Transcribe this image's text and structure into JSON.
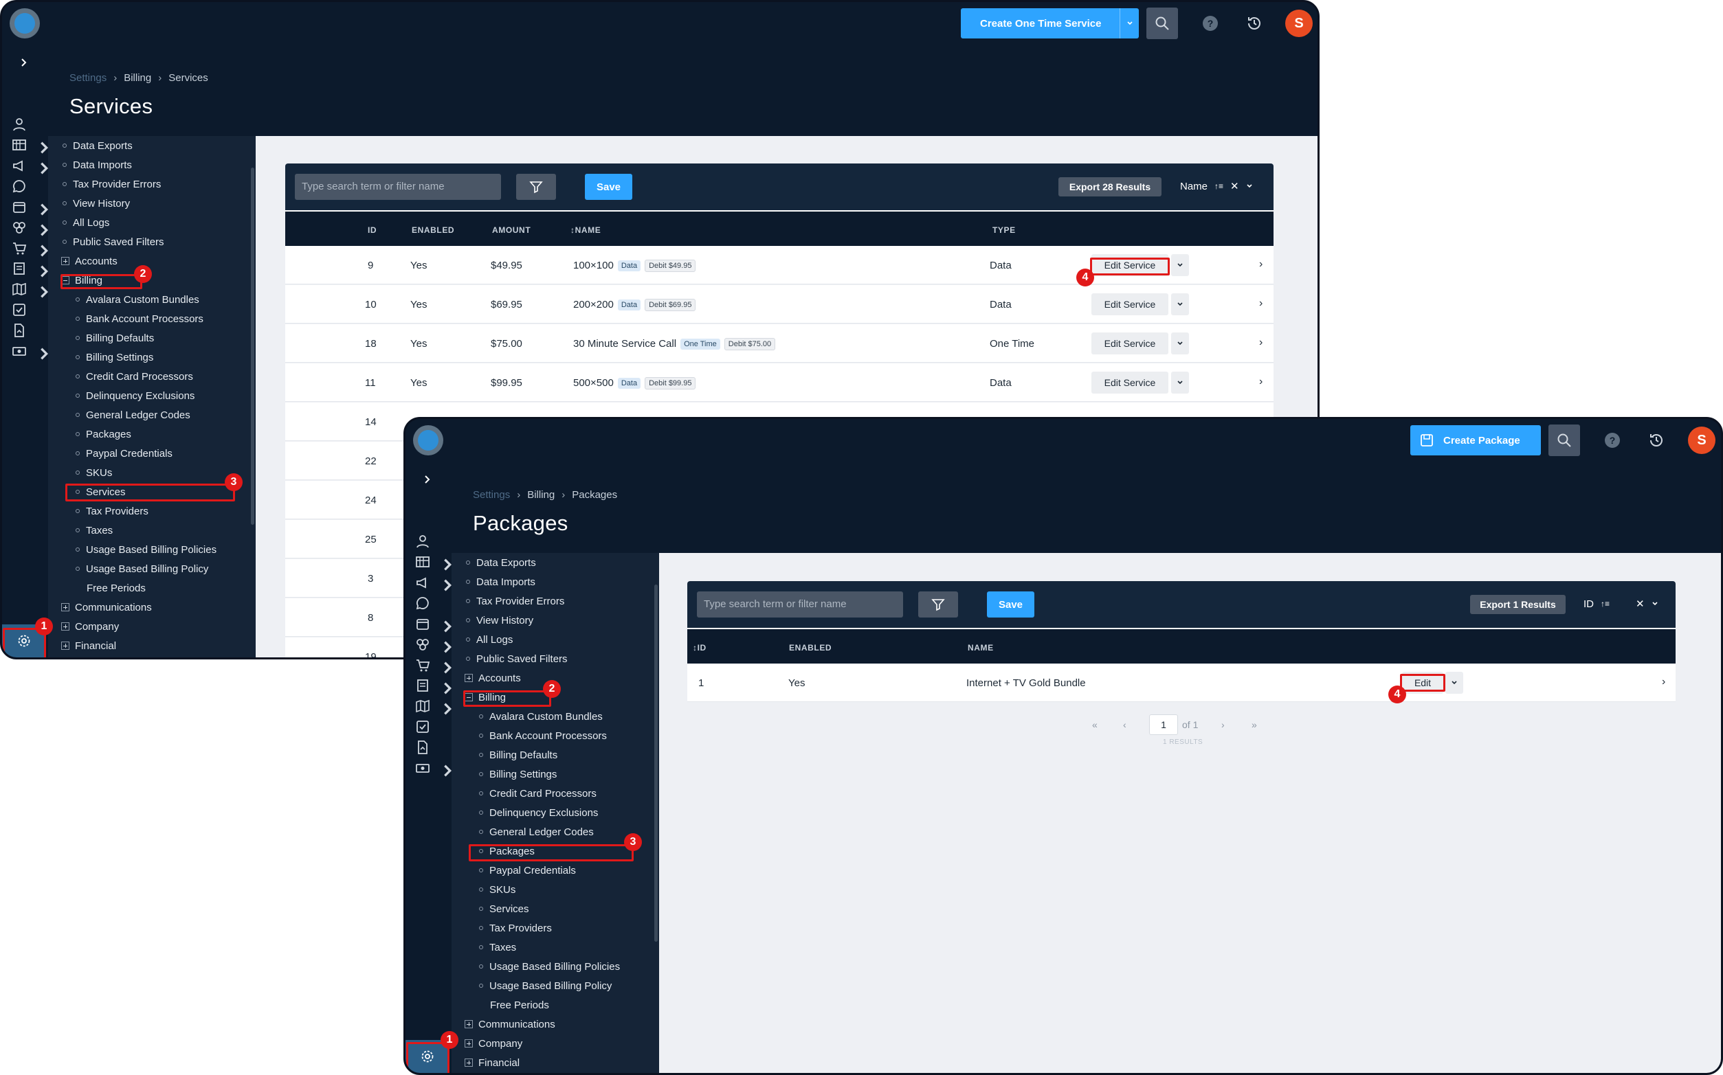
{
  "window_a": {
    "create_button": "Create One Time Service",
    "avatar_letter": "S",
    "breadcrumb": [
      "Settings",
      "Billing",
      "Services"
    ],
    "title": "Services",
    "menu": {
      "top_items": [
        "Data Exports",
        "Data Imports",
        "Tax Provider Errors",
        "View History",
        "All Logs",
        "Public Saved Filters"
      ],
      "accounts": "Accounts",
      "billing": "Billing",
      "billing_items": [
        "Avalara Custom Bundles",
        "Bank Account Processors",
        "Billing Defaults",
        "Billing Settings",
        "Credit Card Processors",
        "Delinquency Exclusions",
        "General Ledger Codes",
        "Packages",
        "Paypal Credentials",
        "SKUs",
        "Services",
        "Tax Providers",
        "Taxes",
        "Usage Based Billing Policies",
        "Usage Based Billing Policy"
      ],
      "free_periods": "Free Periods",
      "bottom_items": [
        "Communications",
        "Company",
        "Financial"
      ]
    },
    "search_placeholder": "Type search term or filter name",
    "save_label": "Save",
    "export_label": "Export 28 Results",
    "sort_label": "Name",
    "columns": [
      "ID",
      "ENABLED",
      "AMOUNT",
      "↕NAME",
      "TYPE"
    ],
    "rows": [
      {
        "id": "9",
        "enabled": "Yes",
        "amount": "$49.95",
        "name": "100×100",
        "tag1": "Data",
        "tag2": "Debit $49.95",
        "type": "Data",
        "action": "Edit Service"
      },
      {
        "id": "10",
        "enabled": "Yes",
        "amount": "$69.95",
        "name": "200×200",
        "tag1": "Data",
        "tag2": "Debit $69.95",
        "type": "Data",
        "action": "Edit Service"
      },
      {
        "id": "18",
        "enabled": "Yes",
        "amount": "$75.00",
        "name": "30 Minute Service Call",
        "tag1": "One Time",
        "tag2": "Debit $75.00",
        "type": "One Time",
        "action": "Edit Service"
      },
      {
        "id": "11",
        "enabled": "Yes",
        "amount": "$99.95",
        "name": "500×500",
        "tag1": "Data",
        "tag2": "Debit $99.95",
        "type": "Data",
        "action": "Edit Service"
      },
      {
        "id": "14"
      },
      {
        "id": "22"
      },
      {
        "id": "24"
      },
      {
        "id": "25"
      },
      {
        "id": "3"
      },
      {
        "id": "8"
      },
      {
        "id": "19"
      }
    ]
  },
  "window_b": {
    "create_button": "Create Package",
    "avatar_letter": "S",
    "breadcrumb": [
      "Settings",
      "Billing",
      "Packages"
    ],
    "title": "Packages",
    "menu": {
      "top_items": [
        "Data Exports",
        "Data Imports",
        "Tax Provider Errors",
        "View History",
        "All Logs",
        "Public Saved Filters"
      ],
      "accounts": "Accounts",
      "billing": "Billing",
      "billing_items": [
        "Avalara Custom Bundles",
        "Bank Account Processors",
        "Billing Defaults",
        "Billing Settings",
        "Credit Card Processors",
        "Delinquency Exclusions",
        "General Ledger Codes",
        "Packages",
        "Paypal Credentials",
        "SKUs",
        "Services",
        "Tax Providers",
        "Taxes",
        "Usage Based Billing Policies",
        "Usage Based Billing Policy"
      ],
      "free_periods": "Free Periods",
      "bottom_items": [
        "Communications",
        "Company",
        "Financial"
      ]
    },
    "search_placeholder": "Type search term or filter name",
    "save_label": "Save",
    "export_label": "Export 1 Results",
    "sort_label": "ID",
    "columns": [
      "↕ID",
      "ENABLED",
      "NAME"
    ],
    "rows": [
      {
        "id": "1",
        "enabled": "Yes",
        "name": "Internet + TV Gold Bundle",
        "action": "Edit"
      }
    ],
    "pager": {
      "first": "«",
      "prev": "‹",
      "page": "1",
      "of": "of 1",
      "next": "›",
      "last": "»",
      "results": "1 RESULTS"
    }
  },
  "annotations": [
    "1",
    "2",
    "3",
    "4"
  ],
  "colors": {
    "navy": "#0c1a2c",
    "accent": "#2ea4ff",
    "highlight": "#e11919",
    "avatar": "#e94b22"
  }
}
